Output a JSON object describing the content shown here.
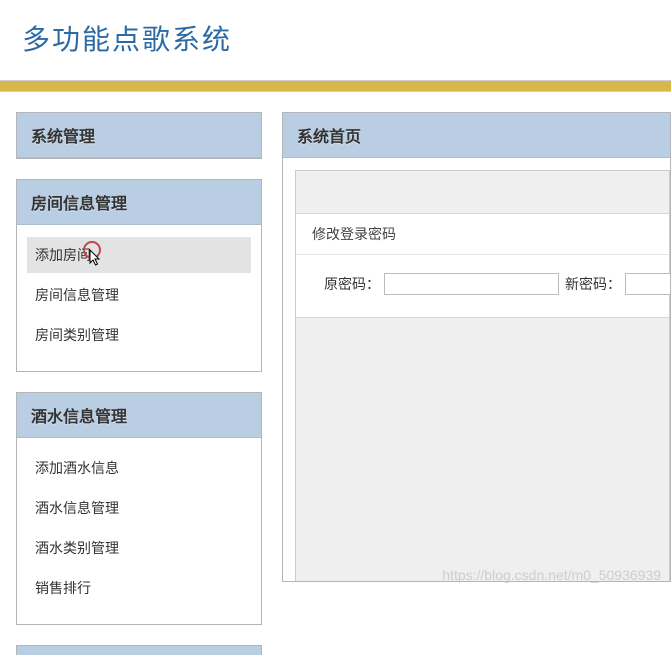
{
  "header": {
    "title": "多功能点歌系统"
  },
  "sidebar": {
    "panels": [
      {
        "title": "系统管理",
        "items": []
      },
      {
        "title": "房间信息管理",
        "items": [
          "添加房间",
          "房间信息管理",
          "房间类别管理"
        ]
      },
      {
        "title": "酒水信息管理",
        "items": [
          "添加酒水信息",
          "酒水信息管理",
          "酒水类别管理",
          "销售排行"
        ]
      }
    ]
  },
  "main": {
    "title": "系统首页",
    "form": {
      "section_title": "修改登录密码",
      "old_label": "原密码：",
      "new_label": "新密码："
    }
  },
  "watermark": "https://blog.csdn.net/m0_50936939"
}
